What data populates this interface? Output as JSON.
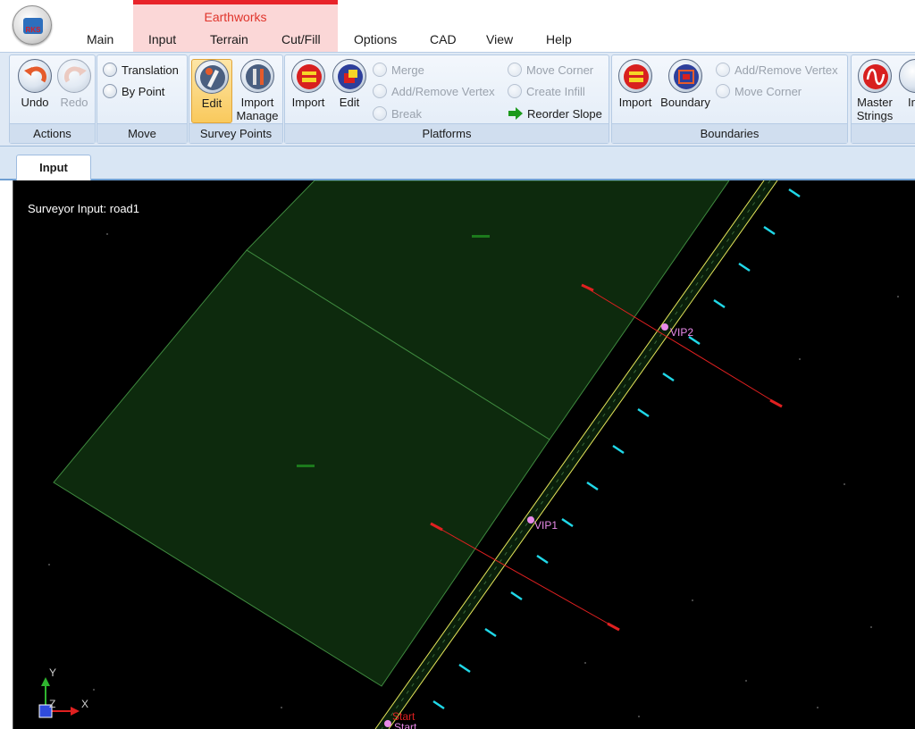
{
  "app_logo_text": "RKS",
  "context_group": "Earthworks",
  "menu": [
    "Main",
    "Input",
    "Terrain",
    "Cut/Fill",
    "Options",
    "CAD",
    "View",
    "Help"
  ],
  "ribbon": {
    "actions": {
      "label": "Actions",
      "undo": "Undo",
      "redo": "Redo"
    },
    "move": {
      "label": "Move",
      "translation": "Translation",
      "by_point": "By Point"
    },
    "survey_points": {
      "label": "Survey Points",
      "edit": "Edit",
      "import_manage_1": "Import",
      "import_manage_2": "Manage"
    },
    "platforms": {
      "label": "Platforms",
      "import": "Import",
      "edit": "Edit",
      "merge": "Merge",
      "add_remove_vertex": "Add/Remove Vertex",
      "break": "Break",
      "move_corner": "Move Corner",
      "create_infill": "Create Infill",
      "reorder_slope": "Reorder Slope"
    },
    "boundaries": {
      "label": "Boundaries",
      "import": "Import",
      "boundary": "Boundary",
      "add_remove_vertex": "Add/Remove Vertex",
      "move_corner": "Move Corner"
    },
    "strings": {
      "master_1": "Master",
      "master_2": "Strings",
      "ind": "Ind"
    }
  },
  "doc_tab": "Input",
  "viewport": {
    "caption": "Surveyor Input: road1",
    "labels": {
      "vip2": "VIP2",
      "vip1": "VIP1",
      "start1": "Start",
      "start2": "Start"
    },
    "axis": {
      "y": "Y",
      "z": "Z",
      "x": "X"
    }
  },
  "colors": {
    "platform_fill": "#0d2a0d",
    "platform_stroke": "#3f8a3f",
    "road_edge": "#e6e65a",
    "road_fill": "#0a1f0a",
    "section_line": "#e02020",
    "cyan_tick": "#20d8e8",
    "vip_marker": "#e98ae9"
  }
}
